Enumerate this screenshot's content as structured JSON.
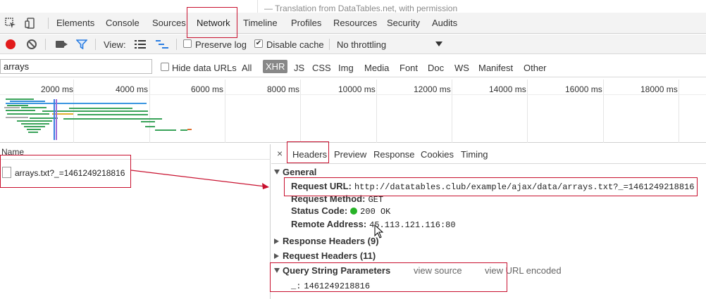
{
  "page": {
    "top_strip_text": "— Translation from DataTables.net, with permission"
  },
  "devtools": {
    "tabs": [
      {
        "label": "Elements"
      },
      {
        "label": "Console"
      },
      {
        "label": "Sources"
      },
      {
        "label": "Network"
      },
      {
        "label": "Timeline"
      },
      {
        "label": "Profiles"
      },
      {
        "label": "Resources"
      },
      {
        "label": "Security"
      },
      {
        "label": "Audits"
      }
    ],
    "active_tab": "Network"
  },
  "toolbar": {
    "view_label": "View:",
    "preserve_log_label": "Preserve log",
    "preserve_log_checked": false,
    "disable_cache_label": "Disable cache",
    "disable_cache_checked": true,
    "throttling": "No throttling"
  },
  "filter": {
    "value": "arrays",
    "hide_data_urls_label": "Hide data URLs",
    "types": [
      "All",
      "XHR",
      "JS",
      "CSS",
      "Img",
      "Media",
      "Font",
      "Doc",
      "WS",
      "Manifest",
      "Other"
    ],
    "selected_type": "XHR"
  },
  "timeline": {
    "ticks": [
      "2000 ms",
      "4000 ms",
      "6000 ms",
      "8000 ms",
      "10000 ms",
      "12000 ms",
      "14000 ms",
      "16000 ms",
      "18000 ms"
    ]
  },
  "requests": {
    "column_name": "Name",
    "rows": [
      {
        "name": "arrays.txt?_=1461249218816"
      }
    ]
  },
  "details": {
    "close_glyph": "×",
    "tabs": [
      "Headers",
      "Preview",
      "Response",
      "Cookies",
      "Timing"
    ],
    "active_tab": "Headers",
    "general": {
      "title": "General",
      "request_url_key": "Request URL:",
      "request_url": "http://datatables.club/example/ajax/data/arrays.txt?_=1461249218816",
      "request_method_key": "Request Method:",
      "request_method": "GET",
      "status_code_key": "Status Code:",
      "status_code": "200 OK",
      "status_color": "#27b327",
      "remote_address_key": "Remote Address:",
      "remote_address": "45.113.121.116:80"
    },
    "response_headers": "Response Headers (9)",
    "request_headers": "Request Headers (11)",
    "query_string": {
      "title": "Query String Parameters",
      "view_source": "view source",
      "view_url_encoded": "view URL encoded",
      "param_key": "_:",
      "param_value": "1461249218816"
    }
  },
  "annotation_color": "#c8102e"
}
